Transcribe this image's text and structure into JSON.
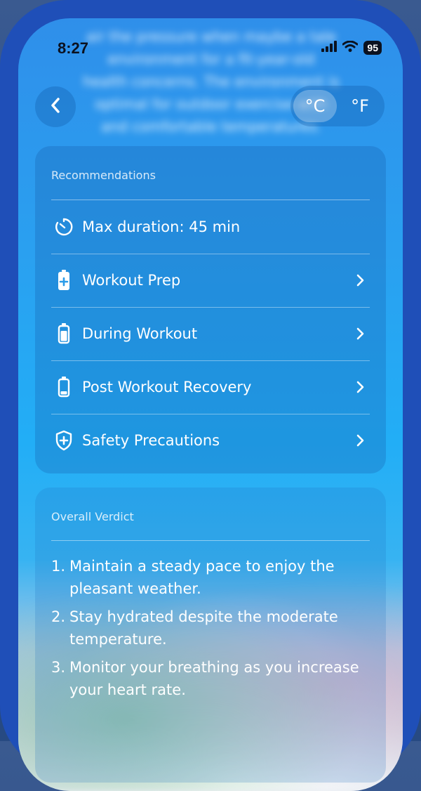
{
  "status_bar": {
    "time": "8:27",
    "battery": "95"
  },
  "header": {
    "blurred_text": [
      "air the pressure when maybe a tale",
      "environment for a fit-year-old",
      "health concerns. The environment is",
      "optimal for outdoor exercise with",
      "and comfortable temperatures."
    ],
    "unit_celsius": "°C",
    "unit_fahrenheit": "°F",
    "selected_unit": "°C"
  },
  "recommendations": {
    "title": "Recommendations",
    "items": [
      {
        "label": "Max duration: 45 min",
        "icon": "timer-icon",
        "has_chevron": false
      },
      {
        "label": "Workout Prep",
        "icon": "battery-plus-icon",
        "has_chevron": true
      },
      {
        "label": "During Workout",
        "icon": "battery-half-icon",
        "has_chevron": true
      },
      {
        "label": "Post Workout Recovery",
        "icon": "battery-low-icon",
        "has_chevron": true
      },
      {
        "label": "Safety Precautions",
        "icon": "shield-plus-icon",
        "has_chevron": true
      }
    ]
  },
  "verdict": {
    "title": "Overall Verdict",
    "items": [
      {
        "num": "1.",
        "text": "Maintain a steady pace to enjoy the pleasant weather."
      },
      {
        "num": "2.",
        "text": "Stay hydrated despite the moderate temperature."
      },
      {
        "num": "3.",
        "text": "Monitor your breathing as you increase your heart rate."
      }
    ]
  },
  "colors": {
    "frame": "#1f4fb8",
    "sky_top": "#2f8fea",
    "sky_mid": "#22aef6",
    "text": "#ffffff"
  }
}
